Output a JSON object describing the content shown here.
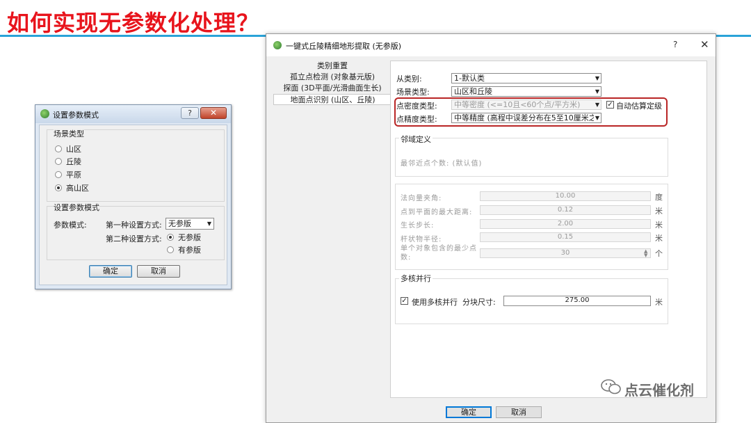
{
  "slide": {
    "title": "如何实现无参数化处理？"
  },
  "small_dialog": {
    "title": "设置参数模式",
    "help": "?",
    "close": "✕",
    "scene_group": "场景类型",
    "scene_options": [
      "山区",
      "丘陵",
      "平原",
      "高山区"
    ],
    "scene_selected": "高山区",
    "param_group": "设置参数模式",
    "param_mode_label": "参数模式:",
    "method1_label": "第一种设置方式:",
    "method1_value": "无参版",
    "method2_label": "第二种设置方式:",
    "method2_options": [
      "无参版",
      "有参版"
    ],
    "method2_selected": "无参版",
    "ok": "确定",
    "cancel": "取消"
  },
  "big_dialog": {
    "title": "一键式丘陵精细地形提取 (无参版)",
    "help": "?",
    "close": "✕",
    "nav": [
      "类别重置",
      "孤立点检测 (对象基元版)",
      "探面 (3D平面/光滑曲面生长)",
      "地面点识别 (山区、丘陵)"
    ],
    "nav_active": "地面点识别 (山区、丘陵)",
    "from_class_label": "从类别:",
    "from_class_value": "1-默认类",
    "scene_type_label": "场景类型:",
    "scene_type_value": "山区和丘陵",
    "density_label": "点密度类型:",
    "density_value": "中等密度 (<=10且<60个点/平方米)",
    "auto_estimate": "自动估算定级",
    "auto_checked": true,
    "precision_label": "点精度类型:",
    "precision_value": "中等精度 (高程中误差分布在5至10厘米之",
    "neighborhood_title": "邻域定义",
    "neighbors_label": "最邻近点个数: (默认值)",
    "params": [
      {
        "label": "法向量夹角:",
        "value": "10.00",
        "unit": "度"
      },
      {
        "label": "点到平面的最大距离:",
        "value": "0.12",
        "unit": "米"
      },
      {
        "label": "生长步长:",
        "value": "2.00",
        "unit": "米"
      },
      {
        "label": "杆状物半径:",
        "value": "0.15",
        "unit": "米"
      },
      {
        "label": "单个对象包含的最少点数:",
        "value": "30",
        "unit": "个"
      }
    ],
    "multicore_title": "多核并行",
    "use_multicore": "使用多核并行",
    "use_multicore_checked": true,
    "block_size_label": "分块尺寸:",
    "block_size_value": "275.00",
    "block_size_unit": "米",
    "ok": "确定",
    "cancel": "取消"
  },
  "watermark": "点云催化剂"
}
